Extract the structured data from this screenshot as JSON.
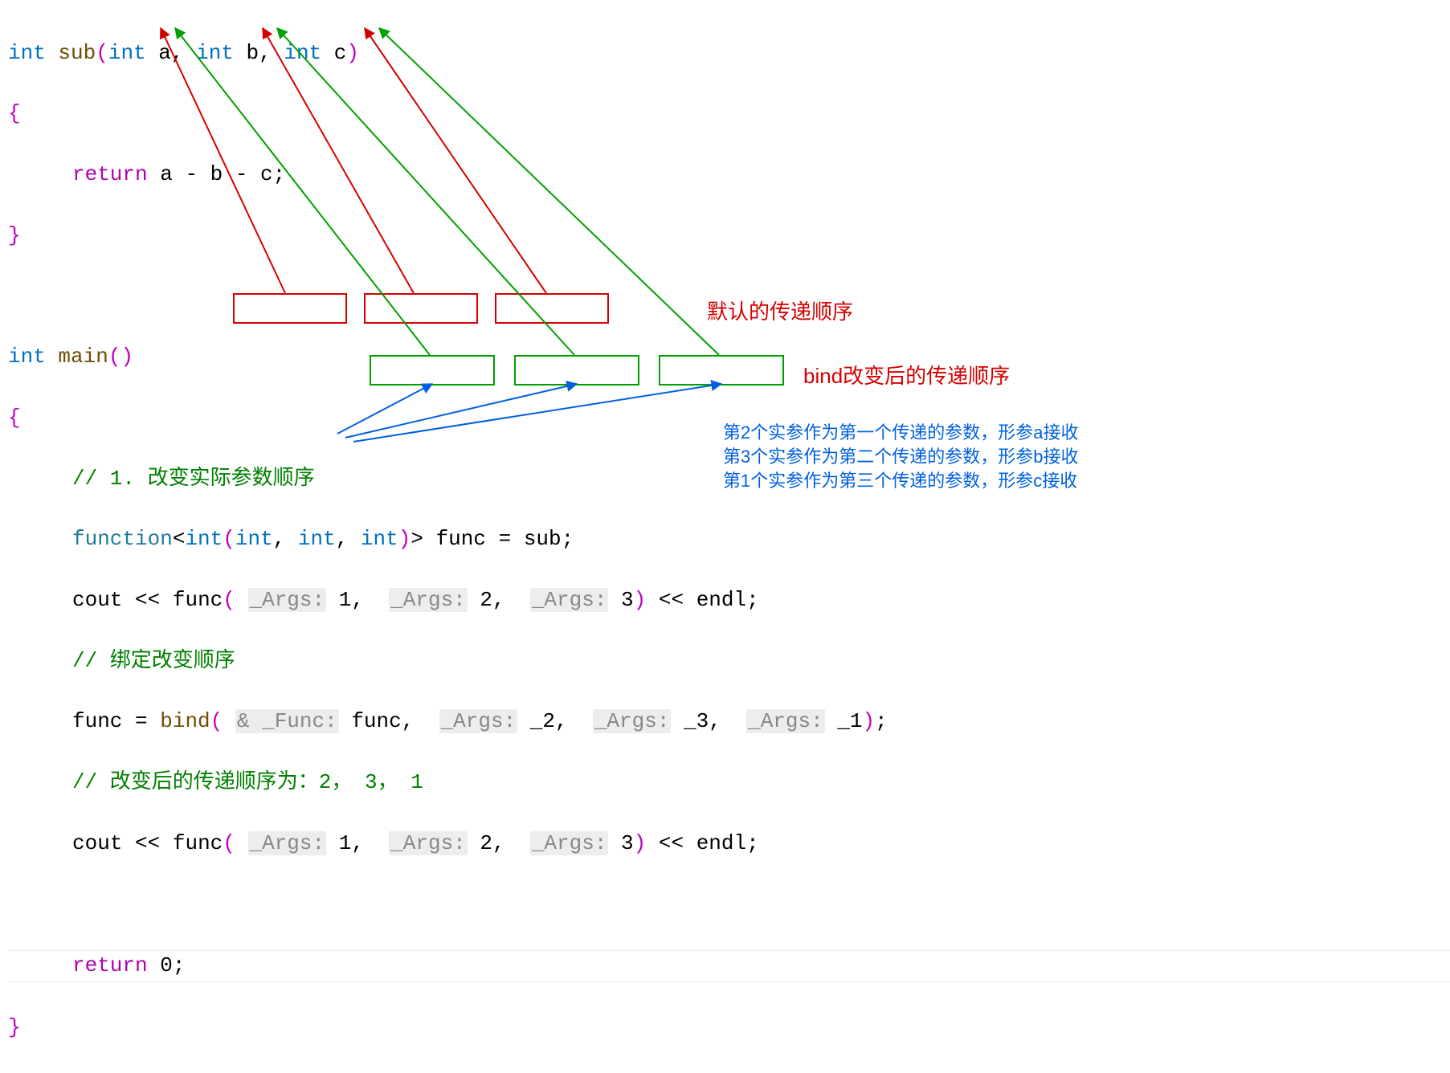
{
  "code": {
    "l1_int": "int",
    "l1_sub": "sub",
    "l1_int_a": "int",
    "l1_a": "a",
    "l1_int_b": "int",
    "l1_b": "b",
    "l1_int_c": "int",
    "l1_c": "c",
    "l3_return": "return",
    "l3_expr": "a - b - c;",
    "l6_int": "int",
    "l6_main": "main",
    "l8_comment": "// 1. 改变实际参数顺序",
    "l9_function": "function",
    "l9_tmpl": "<",
    "l9_int1": "int",
    "l9_int2": "int",
    "l9_int3": "int",
    "l9_int4": "int",
    "l9_tmpl2": ">",
    "l9_func": "func",
    "l9_eq": "=",
    "l9_sub": "sub",
    "l10_cout": "cout",
    "l10_ins": "<<",
    "l10_func": "func",
    "l10_args": "_Args:",
    "l10_v1": "1",
    "l10_v2": "2",
    "l10_v3": "3",
    "l10_endl": "endl;",
    "l11_comment": "// 绑定改变顺序",
    "l12_func": "func",
    "l12_eq": "=",
    "l12_bind": "bind",
    "l12_amp_func": "& _Func:",
    "l12_funcarg": "func",
    "l12_args": "_Args:",
    "l12_p2": "_2",
    "l12_p3": "_3",
    "l12_p1": "_1",
    "l13_comment": "// 改变后的传递顺序为：2， 3， 1",
    "l14_cout": "cout",
    "l14_ins": "<<",
    "l14_func": "func",
    "l14_args": "_Args:",
    "l14_v1": "1",
    "l14_v2": "2",
    "l14_v3": "3",
    "l14_endl": "endl;",
    "l16_return": "return",
    "l16_zero": "0;"
  },
  "annotations": {
    "default_order": "默认的传递顺序",
    "bind_order": "bind改变后的传递顺序",
    "note1": "第2个实参作为第一个传递的参数，形参a接收",
    "note2": "第3个实参作为第二个传递的参数，形参b接收",
    "note3": "第1个实参作为第三个传递的参数，形参c接收"
  }
}
